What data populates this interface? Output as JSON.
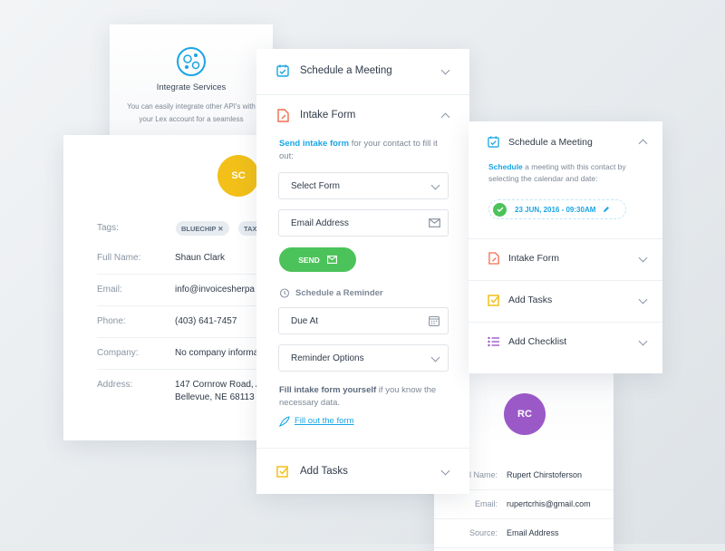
{
  "integrate": {
    "title": "Integrate Services",
    "desc": "You can easily integrate other API's with your Lex account for a seamless"
  },
  "contact": {
    "initials": "SC",
    "tags_label": "Tags:",
    "tags": [
      "BLUECHIP ✕",
      "TAX"
    ],
    "fields": [
      {
        "label": "Full Name:",
        "value": "Shaun Clark"
      },
      {
        "label": "Email:",
        "value": "info@invoicesherpa"
      },
      {
        "label": "Phone:",
        "value": "(403) 641-7457"
      },
      {
        "label": "Company:",
        "value": "No company informa"
      },
      {
        "label": "Address:",
        "value": "147 Cornrow Road, A",
        "value2": "Bellevue, NE 68113"
      }
    ]
  },
  "center": {
    "schedule_title": "Schedule a Meeting",
    "intake_title": "Intake Form",
    "intake_desc_bold": "Send intake form",
    "intake_desc_rest": " for your contact to fill it out:",
    "select_form": "Select Form",
    "email_address": "Email Address",
    "send_label": "SEND",
    "reminder_label": "Schedule a Reminder",
    "due_at": "Due At",
    "reminder_options": "Reminder Options",
    "fill_bold": "Fill intake form yourself",
    "fill_rest": " if you know the necessary data.",
    "fill_link": "Fill out the form",
    "tasks_title": "Add Tasks"
  },
  "right": {
    "schedule_title": "Schedule a Meeting",
    "schedule_desc_bold": "Schedule",
    "schedule_desc_rest": " a meeting with this contact by selecting the calendar and date:",
    "date": "23 JUN, 2016 - 09:30AM",
    "intake_title": "Intake Form",
    "tasks_title": "Add Tasks",
    "checklist_title": "Add Checklist"
  },
  "bottom": {
    "initials": "RC",
    "fields": [
      {
        "label": "l Name:",
        "value": "Rupert Chirstoferson"
      },
      {
        "label": "Email:",
        "value": "rupertcrhis@gmail.com"
      },
      {
        "label": "Source:",
        "value": "Email Address"
      }
    ]
  },
  "colors": {
    "accent_blue": "#1aa5e4",
    "green": "#4cc35a",
    "yellow": "#f2c018",
    "purple": "#9b59c8",
    "orange": "#f26d50"
  }
}
